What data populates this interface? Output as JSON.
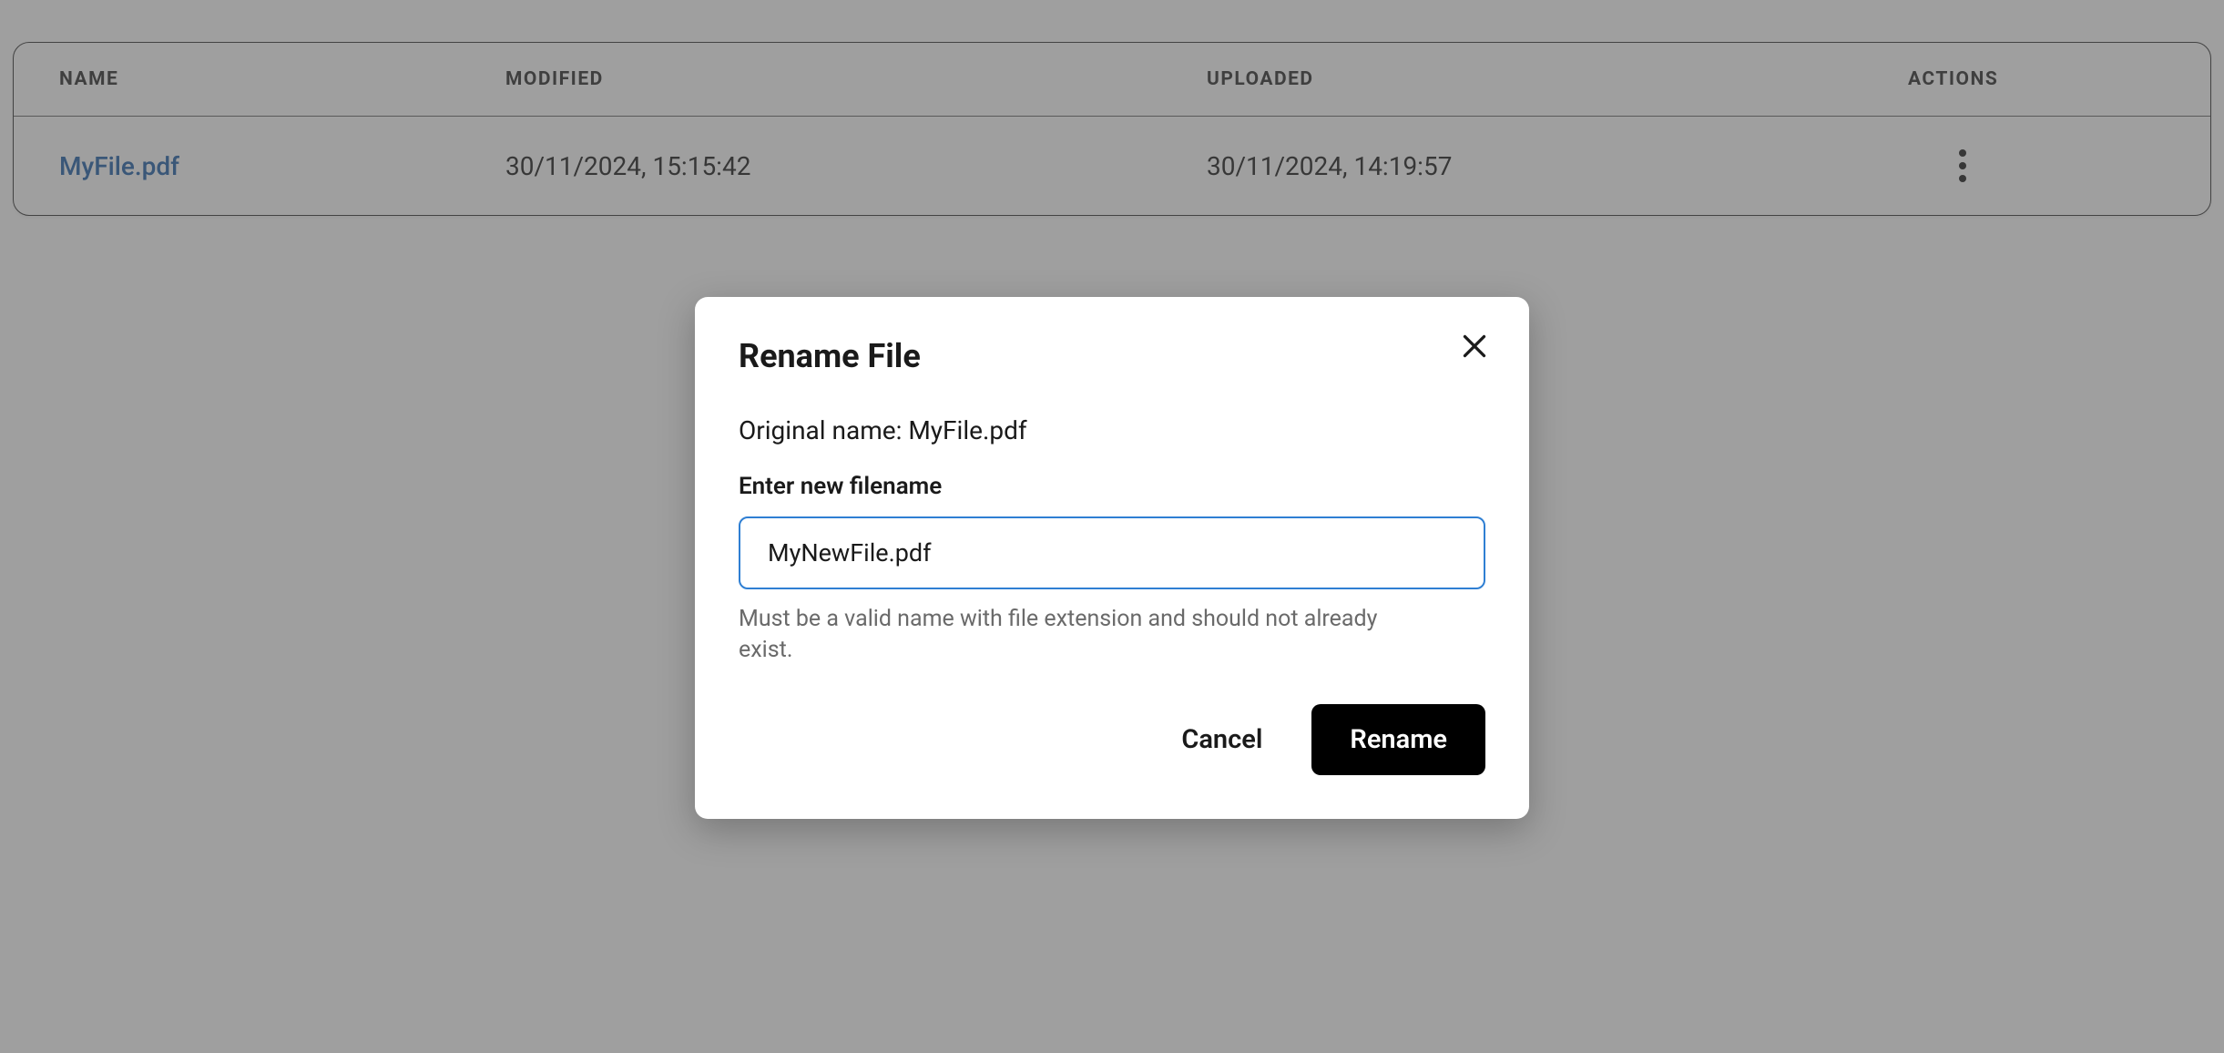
{
  "table": {
    "headers": {
      "name": "NAME",
      "modified": "MODIFIED",
      "uploaded": "UPLOADED",
      "actions": "ACTIONS"
    },
    "rows": [
      {
        "name": "MyFile.pdf",
        "modified": "30/11/2024, 15:15:42",
        "uploaded": "30/11/2024, 14:19:57"
      }
    ]
  },
  "modal": {
    "title": "Rename File",
    "original_label": "Original name: MyFile.pdf",
    "field_label": "Enter new filename",
    "input_value": "MyNewFile.pdf",
    "help_text": "Must be a valid name with file extension and should not already exist.",
    "cancel_label": "Cancel",
    "rename_label": "Rename"
  }
}
